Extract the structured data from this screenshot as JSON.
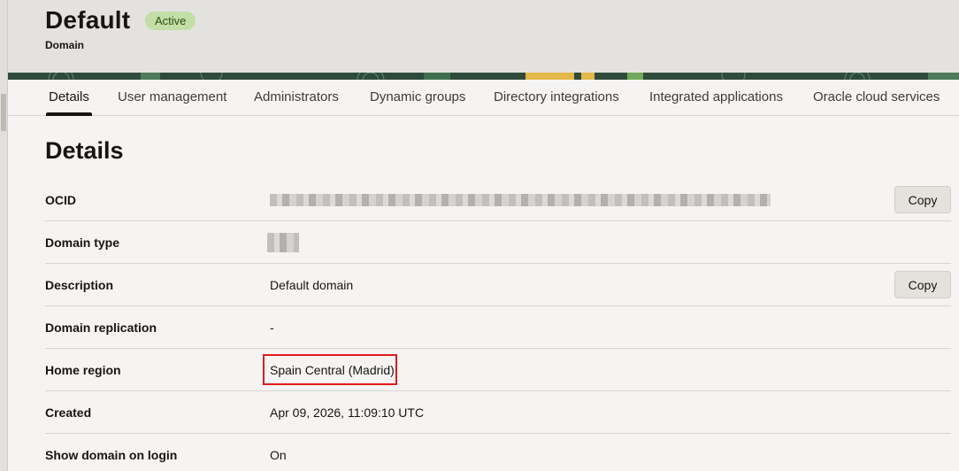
{
  "header": {
    "title": "Default",
    "status": "Active",
    "subtitle": "Domain"
  },
  "tabs": [
    {
      "label": "Details",
      "active": true
    },
    {
      "label": "User management",
      "active": false
    },
    {
      "label": "Administrators",
      "active": false
    },
    {
      "label": "Dynamic groups",
      "active": false
    },
    {
      "label": "Directory integrations",
      "active": false
    },
    {
      "label": "Integrated applications",
      "active": false
    },
    {
      "label": "Oracle cloud services",
      "active": false
    }
  ],
  "details": {
    "section_title": "Details",
    "copy_label": "Copy",
    "rows": [
      {
        "label": "OCID",
        "value": ""
      },
      {
        "label": "Domain type",
        "value": ""
      },
      {
        "label": "Description",
        "value": "Default domain"
      },
      {
        "label": "Domain replication",
        "value": "-"
      },
      {
        "label": "Home region",
        "value": "Spain Central (Madrid)"
      },
      {
        "label": "Created",
        "value": "Apr 09, 2026, 11:09:10 UTC"
      },
      {
        "label": "Show domain on login",
        "value": "On"
      }
    ]
  },
  "colors": {
    "status_badge_bg": "#c3dea7",
    "highlight": "#e01a1a",
    "banner": "#2f4b3c"
  }
}
